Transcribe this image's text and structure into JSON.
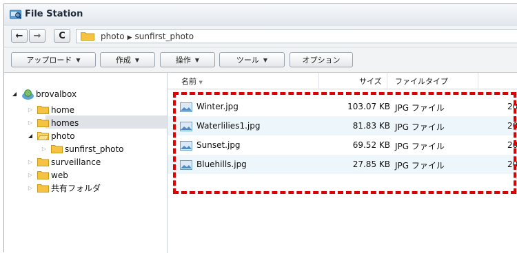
{
  "window": {
    "title": "File Station"
  },
  "nav": {
    "back_icon": "back-arrow-icon",
    "forward_icon": "forward-arrow-icon",
    "refresh_icon": "refresh-icon",
    "path": {
      "root": "photo",
      "separator": "▶",
      "current": "sunfirst_photo"
    }
  },
  "toolbar": {
    "upload_label": "アップロード",
    "create_label": "作成",
    "action_label": "操作",
    "tools_label": "ツール",
    "options_label": "オプション"
  },
  "tree": {
    "root": "brovalbox",
    "items": [
      {
        "label": "home",
        "level": 1,
        "expanded": false
      },
      {
        "label": "homes",
        "level": 1,
        "expanded": false
      },
      {
        "label": "photo",
        "level": 1,
        "expanded": true
      },
      {
        "label": "sunfirst_photo",
        "level": 2,
        "expanded": false,
        "selected": true
      },
      {
        "label": "surveillance",
        "level": 1,
        "expanded": false
      },
      {
        "label": "web",
        "level": 1,
        "expanded": false
      },
      {
        "label": "共有フォルダ",
        "level": 1,
        "expanded": false
      }
    ]
  },
  "list": {
    "columns": {
      "name": "名前",
      "size": "サイズ",
      "type": "ファイルタイプ"
    },
    "sort_indicator": "▼",
    "files": [
      {
        "name": "Winter.jpg",
        "size": "103.07 KB",
        "type": "JPG ファイル",
        "date": "20"
      },
      {
        "name": "Waterlilies1.jpg",
        "size": "81.83 KB",
        "type": "JPG ファイル",
        "date": "20"
      },
      {
        "name": "Sunset.jpg",
        "size": "69.52 KB",
        "type": "JPG ファイル",
        "date": "20"
      },
      {
        "name": "Bluehills.jpg",
        "size": "27.85 KB",
        "type": "JPG ファイル",
        "date": "20"
      }
    ]
  },
  "colors": {
    "highlight": "#e00000",
    "folder": "#f5c341",
    "selected_row": "#dfe3e8",
    "alt_row": "#edf6fb"
  }
}
